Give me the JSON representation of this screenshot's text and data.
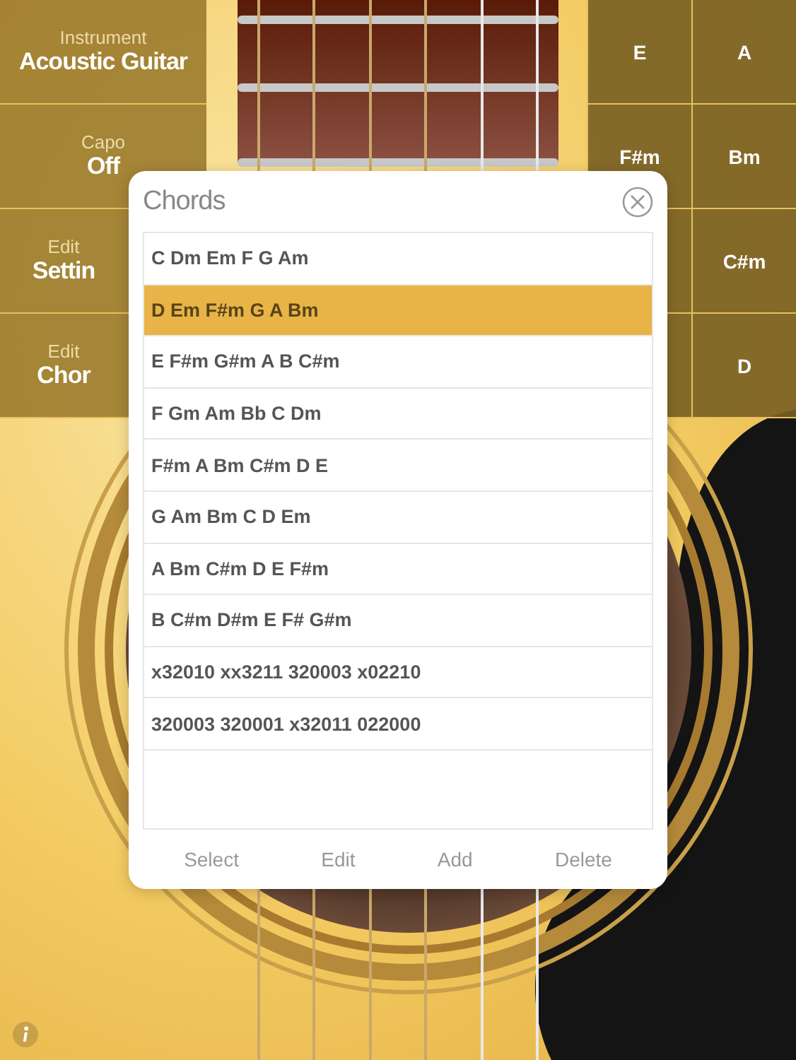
{
  "settings": [
    {
      "label": "Instrument",
      "value": "Acoustic Guitar"
    },
    {
      "label": "Capo",
      "value": "Off"
    },
    {
      "label": "Edit",
      "value": "Settin"
    },
    {
      "label": "Edit",
      "value": "Chor"
    }
  ],
  "chord_pads": {
    "column_1": [
      "E",
      "F#m"
    ],
    "column_2": [
      "A",
      "Bm",
      "C#m",
      "D"
    ]
  },
  "dialog": {
    "title": "Chords",
    "rows": [
      {
        "text": "C Dm Em F G Am",
        "selected": false
      },
      {
        "text": "D Em F#m G A Bm",
        "selected": true
      },
      {
        "text": "E F#m G#m A B C#m",
        "selected": false
      },
      {
        "text": "F Gm Am Bb C Dm",
        "selected": false
      },
      {
        "text": "F#m A Bm C#m D E",
        "selected": false
      },
      {
        "text": "G Am Bm C D Em",
        "selected": false
      },
      {
        "text": "A Bm C#m D E F#m",
        "selected": false
      },
      {
        "text": "B C#m D#m E F# G#m",
        "selected": false
      },
      {
        "text": "x32010 xx3211 320003 x02210",
        "selected": false
      },
      {
        "text": "320003 320001 x32011 022000",
        "selected": false
      }
    ],
    "buttons": [
      "Select",
      "Edit",
      "Add",
      "Delete"
    ]
  }
}
